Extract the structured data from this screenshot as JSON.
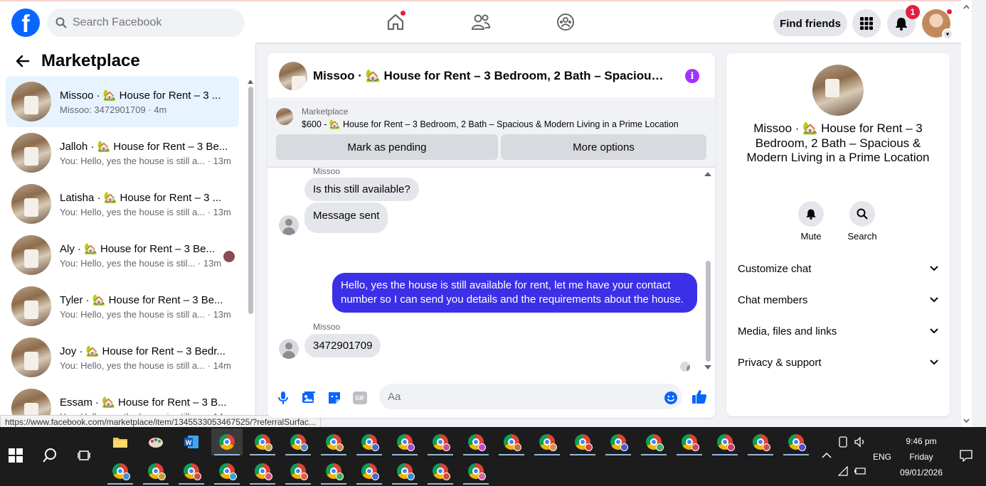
{
  "topbar": {
    "search_placeholder": "Search Facebook",
    "find_friends": "Find friends",
    "notification_count": "1"
  },
  "sidebar": {
    "title": "Marketplace",
    "conversations": [
      {
        "name": "Missoo · 🏡 House for Rent – 3 ...",
        "sub": "Missoo: 3472901709 · 4m"
      },
      {
        "name": "Jalloh · 🏡 House for Rent – 3 Be...",
        "sub": "You: Hello, yes the house is still a... · 13m"
      },
      {
        "name": "Latisha · 🏡 House for Rent – 3 ...",
        "sub": "You: Hello, yes the house is still a... · 13m"
      },
      {
        "name": "Aly · 🏡 House for Rent – 3 Be...",
        "sub": "You: Hello, yes the house is stil... · 13m"
      },
      {
        "name": "Tyler · 🏡 House for Rent – 3 Be...",
        "sub": "You: Hello, yes the house is still a... · 13m"
      },
      {
        "name": "Joy · 🏡 House for Rent – 3 Bedr...",
        "sub": "You: Hello, yes the house is still a... · 14m"
      },
      {
        "name": "Essam · 🏡 House for Rent – 3 B...",
        "sub": "You: Hello, yes the house is still a... · 14m"
      }
    ]
  },
  "status_url": "https://www.facebook.com/marketplace/item/1345533053467525/?referralSurfac...",
  "chat": {
    "title": "Missoo · 🏡 House for Rent – 3 Bedroom, 2 Bath – Spacious & Modern Living in a Prime Location",
    "listing": {
      "category": "Marketplace",
      "description": "$600 - 🏡 House for Rent – 3 Bedroom, 2 Bath – Spacious & Modern Living in a Prime Location",
      "mark_pending": "Mark as pending",
      "more_options": "More options"
    },
    "messages": {
      "sender1": "Missoo",
      "in1": "Is this still available?",
      "in2": "Message sent",
      "out1": "Hello, yes the house is still available for rent, let me have your contact number so I can send you details and the requirements about the house.",
      "sender2": "Missoo",
      "in3": "3472901709"
    },
    "composer_placeholder": "Aa",
    "gif_label": "GIF"
  },
  "info": {
    "title": "Missoo · 🏡 House for Rent – 3 Bedroom, 2 Bath – Spacious & Modern Living in a Prime Location",
    "mute": "Mute",
    "search": "Search",
    "rows": [
      "Customize chat",
      "Chat members",
      "Media, files and links",
      "Privacy & support"
    ]
  },
  "taskbar": {
    "time": "9:46 pm",
    "day": "Friday",
    "date": "09/01/2026",
    "lang": "ENG"
  }
}
